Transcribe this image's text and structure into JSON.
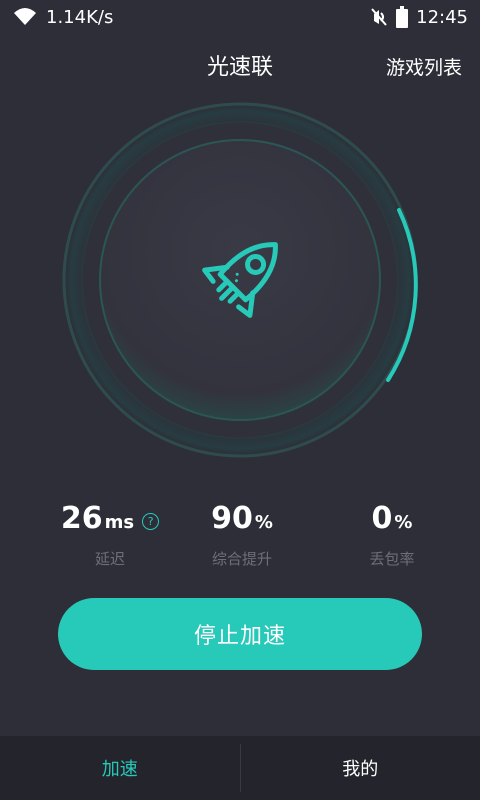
{
  "status_bar": {
    "speed": "1.14K/s",
    "time": "12:45"
  },
  "header": {
    "title": "光速联",
    "game_list": "游戏列表"
  },
  "stats": [
    {
      "value": "26",
      "unit": "ms",
      "label": "延迟"
    },
    {
      "value": "90",
      "unit": "%",
      "label": "综合提升"
    },
    {
      "value": "0",
      "unit": "%",
      "label": "丢包率"
    }
  ],
  "help_icon_text": "?",
  "stop_button": "停止加速",
  "bottom_nav": {
    "items": [
      {
        "label": "加速",
        "active": true
      },
      {
        "label": "我的",
        "active": false
      }
    ]
  },
  "colors": {
    "accent": "#27c9b8",
    "background": "#2e2e38",
    "muted_text": "#6e6e78"
  },
  "icons": [
    "wifi-icon",
    "mute-icon",
    "battery-icon",
    "rocket-icon",
    "help-icon"
  ]
}
